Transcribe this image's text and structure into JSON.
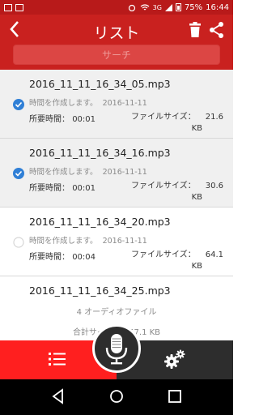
{
  "status_bar": {
    "network": "3G",
    "battery": "75%",
    "time": "16:44"
  },
  "header": {
    "title": "リスト",
    "search_placeholder": "サーチ"
  },
  "recordings": [
    {
      "filename": "2016_11_11_16_34_05.mp3",
      "created_label": "時間を作成します。",
      "created_date": "2016-11-11",
      "duration_label": "所要時間：",
      "duration": "00:01",
      "size_label": "ファイルサイズ：",
      "size_value": "21.6",
      "size_unit": "KB",
      "selected": true
    },
    {
      "filename": "2016_11_11_16_34_16.mp3",
      "created_label": "時間を作成します。",
      "created_date": "2016-11-11",
      "duration_label": "所要時間：",
      "duration": "00:01",
      "size_label": "ファイルサイズ：",
      "size_value": "30.6",
      "size_unit": "KB",
      "selected": true
    },
    {
      "filename": "2016_11_11_16_34_20.mp3",
      "created_label": "時間を作成します。",
      "created_date": "2016-11-11",
      "duration_label": "所要時間：",
      "duration": "00:04",
      "size_label": "ファイルサイズ：",
      "size_value": "64.1",
      "size_unit": "KB",
      "selected": false
    },
    {
      "filename": "2016_11_11_16_34_25.mp3"
    }
  ],
  "summary": {
    "file_count": "4 オーディオファイル",
    "total_size": "合計サイズ： 157.1 KB"
  },
  "colors": {
    "status_bar": "#b81a1a",
    "app_bar": "#c9211f",
    "search_bg": "#dc4644",
    "check_blue": "#2f7fd6",
    "tab_active": "#ff1f1f",
    "tab_dark": "#2d2d2d"
  },
  "icons": {
    "back": "chevron-left-icon",
    "trash": "trash-icon",
    "share": "share-icon",
    "list_tab": "list-icon",
    "record": "microphone-icon",
    "settings_tab": "gear-icon"
  }
}
